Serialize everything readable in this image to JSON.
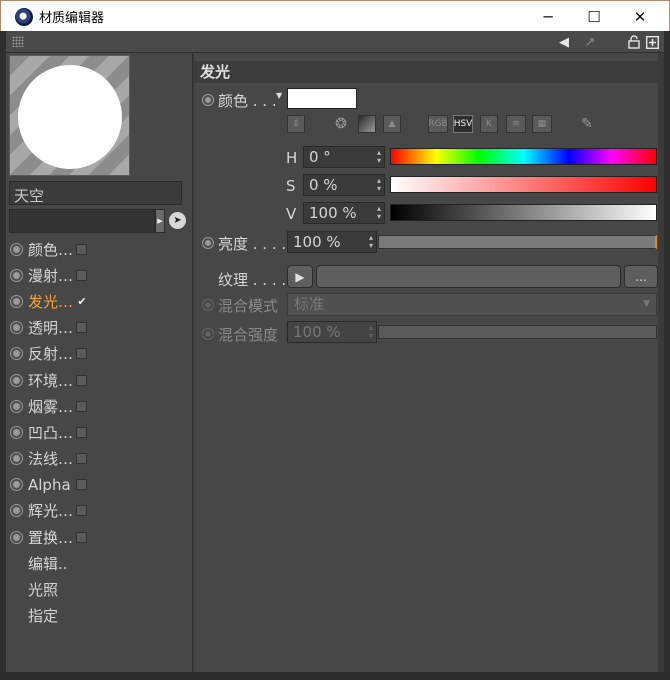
{
  "window": {
    "title": "材质编辑器",
    "minimize_glyph": "─",
    "maximize_glyph": "☐",
    "close_glyph": "✕"
  },
  "toolbar": {
    "icons": [
      "grip-icon",
      "arrow-left-icon",
      "arrow-diag-icon",
      "lock-icon",
      "new-window-icon"
    ]
  },
  "material": {
    "name": "天空",
    "layer_field": ""
  },
  "channels": [
    {
      "label": "颜色…",
      "checked": false,
      "active": false
    },
    {
      "label": "漫射…",
      "checked": false,
      "active": false
    },
    {
      "label": "发光…",
      "checked": true,
      "active": true
    },
    {
      "label": "透明…",
      "checked": false,
      "active": false
    },
    {
      "label": "反射…",
      "checked": false,
      "active": false
    },
    {
      "label": "环境…",
      "checked": false,
      "active": false
    },
    {
      "label": "烟雾…",
      "checked": false,
      "active": false
    },
    {
      "label": "凹凸…",
      "checked": false,
      "active": false
    },
    {
      "label": "法线…",
      "checked": false,
      "active": false
    },
    {
      "label": "Alpha",
      "checked": false,
      "active": false
    },
    {
      "label": "辉光…",
      "checked": false,
      "active": false
    },
    {
      "label": "置换…",
      "checked": false,
      "active": false
    }
  ],
  "extra_items": [
    "编辑..",
    "光照",
    "指定"
  ],
  "section": {
    "title": "发光",
    "color_label": "颜色 . . .",
    "color_value": "#ffffff",
    "color_modes": [
      "RGB",
      "HSV",
      "K"
    ],
    "selected_mode": "HSV",
    "h_label": "H",
    "h_value": "0 °",
    "s_label": "S",
    "s_value": "0 %",
    "v_label": "V",
    "v_value": "100 %",
    "brightness_label": "亮度 . . . . .",
    "brightness_value": "100 %",
    "brightness_fraction": 1.0,
    "texture_label": "纹理 . . . . .",
    "texture_more": "...",
    "blend_mode_label": "混合模式",
    "blend_mode_value": "标准",
    "blend_strength_label": "混合强度",
    "blend_strength_value": "100 %"
  }
}
